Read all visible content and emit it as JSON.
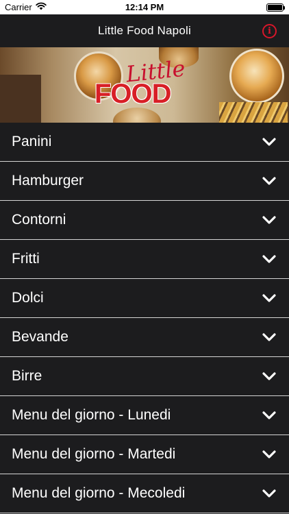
{
  "status_bar": {
    "carrier": "Carrier",
    "time": "12:14 PM"
  },
  "nav": {
    "title": "Little Food Napoli",
    "info_icon": "info-circle-icon"
  },
  "hero": {
    "logo_script": "Little",
    "logo_main": "FOOD"
  },
  "colors": {
    "accent": "#d8162a",
    "background": "#1c1c1e",
    "divider": "#d6d6d6"
  },
  "menu": {
    "items": [
      {
        "label": "Panini"
      },
      {
        "label": "Hamburger"
      },
      {
        "label": "Contorni"
      },
      {
        "label": "Fritti"
      },
      {
        "label": "Dolci"
      },
      {
        "label": "Bevande"
      },
      {
        "label": "Birre"
      },
      {
        "label": "Menu del giorno - Lunedi"
      },
      {
        "label": "Menu del giorno - Martedi"
      },
      {
        "label": "Menu del giorno - Mecoledi"
      }
    ]
  }
}
